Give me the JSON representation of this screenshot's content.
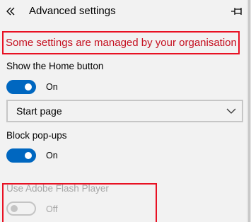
{
  "header": {
    "back_icon": "chevron-double-left-icon",
    "title": "Advanced settings",
    "pin_icon": "pin-icon"
  },
  "notice": {
    "text": "Some settings are managed by your organisation",
    "color": "#c50f1f",
    "border_color": "#e81123"
  },
  "settings": {
    "home_button": {
      "label": "Show the Home button",
      "state": "On",
      "enabled": true
    },
    "home_page_select": {
      "value": "Start page"
    },
    "block_popups": {
      "label": "Block pop-ups",
      "state": "On",
      "enabled": true
    },
    "flash_player": {
      "label": "Use Adobe Flash Player",
      "state": "Off",
      "enabled": false,
      "disabled": true
    }
  },
  "colors": {
    "accent": "#0067c0",
    "background": "#f2f2f2",
    "disabled_text": "#a6a6a6"
  }
}
